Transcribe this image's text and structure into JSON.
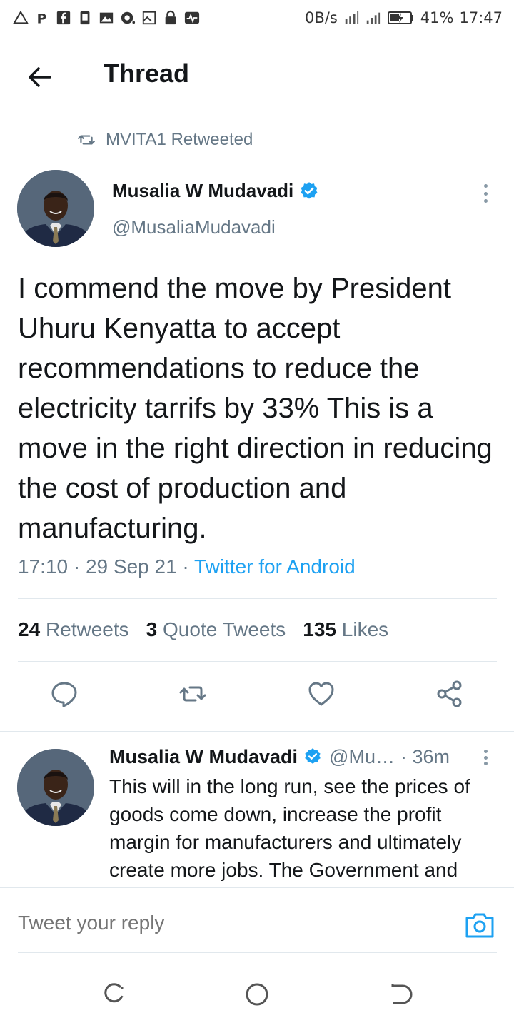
{
  "status_bar": {
    "net_speed": "0B/s",
    "battery": "41%",
    "time": "17:47",
    "icons": [
      "alert-triangle-icon",
      "parking-icon",
      "facebook-icon",
      "screenshot-icon",
      "gallery-icon",
      "chat-icon",
      "image-icon",
      "lock-icon",
      "activity-icon"
    ]
  },
  "header": {
    "title": "Thread"
  },
  "retweet_context": {
    "text": "MVITA1 Retweeted"
  },
  "tweet": {
    "author_name": "Musalia W Mudavadi",
    "author_handle": "@MusaliaMudavadi",
    "text": "I commend the move by President Uhuru Kenyatta to accept recommendations to reduce the electricity tarrifs by 33% This is a move in the right direction in reducing the cost of production and manufacturing.",
    "time": "17:10",
    "date": "29 Sep 21",
    "source": "Twitter for Android",
    "retweets_count": "24",
    "retweets_label": "Retweets",
    "quotes_count": "3",
    "quotes_label": "Quote Tweets",
    "likes_count": "135",
    "likes_label": "Likes"
  },
  "reply": {
    "author_name": "Musalia W Mudavadi",
    "author_handle": "@Mu…",
    "time": "· 36m",
    "text": "This will in the long run, see the prices of goods come down, increase the profit margin for manufacturers and ultimately create more jobs. The Government and"
  },
  "reply_box": {
    "placeholder": "Tweet your reply"
  },
  "colors": {
    "accent": "#1da1f2",
    "secondary_text": "#657786",
    "divider": "#e1e8ed"
  }
}
